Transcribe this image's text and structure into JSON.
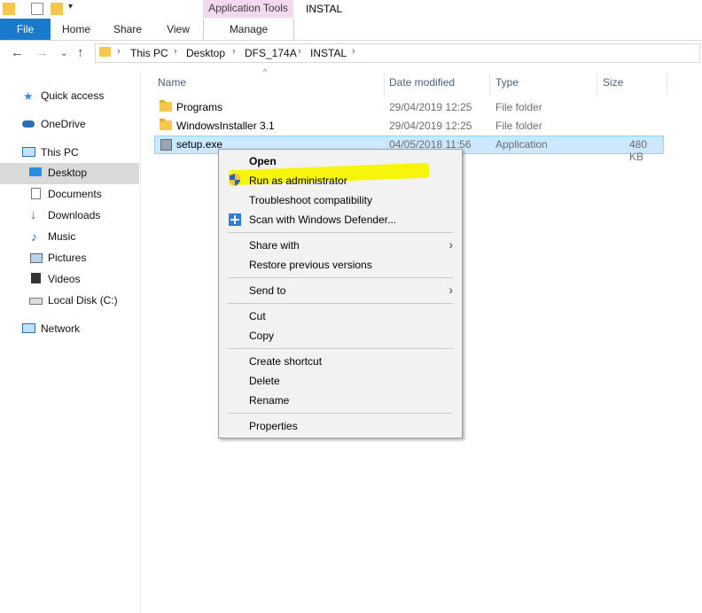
{
  "ribbon": {
    "app_tools": "Application Tools",
    "window_title": "INSTAL",
    "tabs": [
      "File",
      "Home",
      "Share",
      "View",
      "Manage"
    ]
  },
  "address": {
    "crumbs": [
      "This PC",
      "Desktop",
      "DFS_174A",
      "INSTAL"
    ]
  },
  "sidebar": {
    "items": [
      {
        "label": "Quick access",
        "icon": "star-icon"
      },
      {
        "label": "OneDrive",
        "icon": "cloud-icon"
      },
      {
        "label": "This PC",
        "icon": "computer-icon"
      },
      {
        "label": "Desktop",
        "icon": "desktop-icon"
      },
      {
        "label": "Documents",
        "icon": "document-icon"
      },
      {
        "label": "Downloads",
        "icon": "download-arrow-icon"
      },
      {
        "label": "Music",
        "icon": "music-note-icon"
      },
      {
        "label": "Pictures",
        "icon": "picture-icon"
      },
      {
        "label": "Videos",
        "icon": "film-icon"
      },
      {
        "label": "Local Disk (C:)",
        "icon": "drive-icon"
      },
      {
        "label": "Network",
        "icon": "network-icon"
      }
    ]
  },
  "columns": [
    "Name",
    "Date modified",
    "Type",
    "Size"
  ],
  "files": [
    {
      "name": "Programs",
      "date": "29/04/2019 12:25",
      "type": "File folder",
      "size": ""
    },
    {
      "name": "WindowsInstaller 3.1",
      "date": "29/04/2019 12:25",
      "type": "File folder",
      "size": ""
    },
    {
      "name": "setup.exe",
      "date": "04/05/2018 11:56",
      "type": "Application",
      "size": "480 KB"
    }
  ],
  "context_menu": {
    "items": [
      {
        "label": "Open"
      },
      {
        "label": "Run as administrator"
      },
      {
        "label": "Troubleshoot compatibility"
      },
      {
        "label": "Scan with Windows Defender..."
      },
      {
        "label": "Share with"
      },
      {
        "label": "Restore previous versions"
      },
      {
        "label": "Send to"
      },
      {
        "label": "Cut"
      },
      {
        "label": "Copy"
      },
      {
        "label": "Create shortcut"
      },
      {
        "label": "Delete"
      },
      {
        "label": "Rename"
      },
      {
        "label": "Properties"
      }
    ]
  },
  "colors": {
    "accent": "#1979ca",
    "selection": "#cce8ff",
    "highlight": "#f8f400"
  }
}
